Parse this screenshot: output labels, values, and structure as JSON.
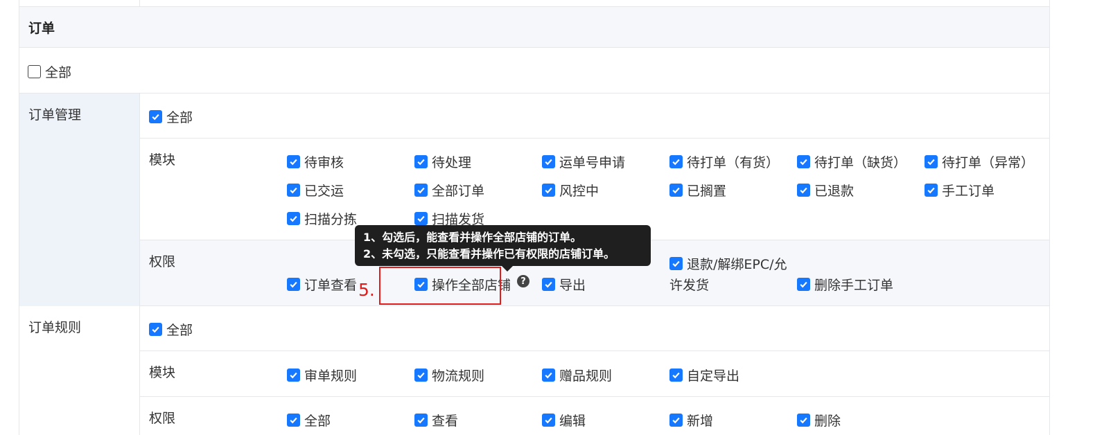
{
  "section": {
    "title": "订单"
  },
  "all_toggle": {
    "label": "全部",
    "checked": false
  },
  "groups": [
    {
      "label": "订单管理",
      "all": {
        "label": "全部",
        "checked": true
      },
      "module_label": "模块",
      "modules": [
        "待审核",
        "待处理",
        "运单号申请",
        "待打单（有货）",
        "待打单（缺货）",
        "待打单（异常）",
        "已交运",
        "全部订单",
        "风控中",
        "已搁置",
        "已退款",
        "手工订单",
        "扫描分拣",
        "扫描发货"
      ],
      "permission_label": "权限",
      "permissions": [
        "订单查看",
        "操作全部店铺",
        "导出",
        "退款/解绑EPC/允",
        "许发货",
        "删除手工订单"
      ]
    },
    {
      "label": "订单规则",
      "all": {
        "label": "全部",
        "checked": true
      },
      "module_label": "模块",
      "modules": [
        "审单规则",
        "物流规则",
        "赠品规则",
        "自定导出"
      ],
      "permission_label": "权限",
      "permissions": [
        "全部",
        "查看",
        "编辑",
        "新增",
        "删除"
      ]
    }
  ],
  "tooltip": {
    "line1": "1、勾选后，能查看并操作全部店铺的订单。",
    "line2": "2、未勾选，只能查看并操作已有权限的店铺订单。"
  },
  "help_icon": {
    "name": "question-circle-icon",
    "glyph": "?"
  },
  "annotation": {
    "step": "5.",
    "color": "#e21b1b"
  },
  "colors": {
    "checkbox": "#1677ff",
    "header_bg": "#f5f7fa",
    "group_bg": "#eef2f9",
    "highlight_bg": "#f5f7fa"
  }
}
